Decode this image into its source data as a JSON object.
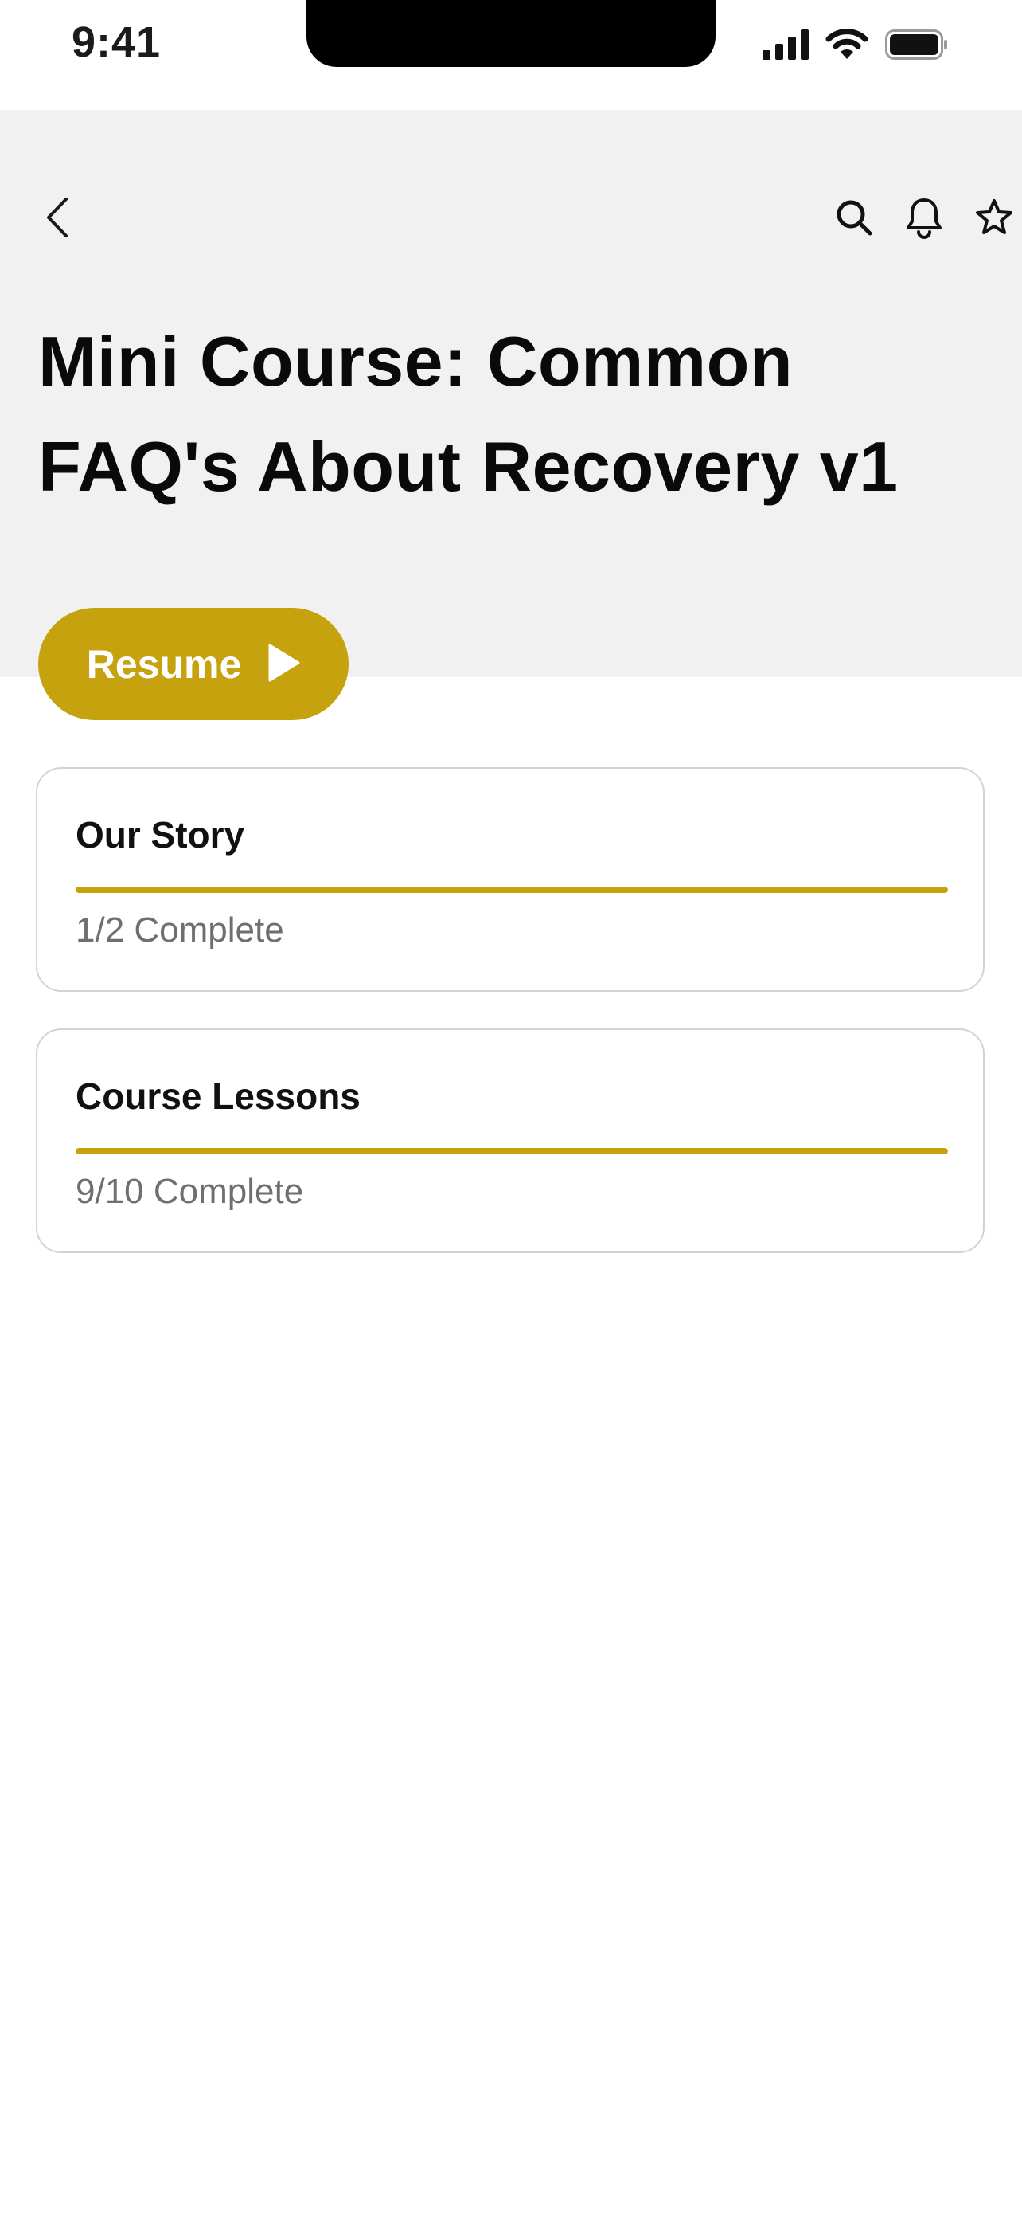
{
  "status_bar": {
    "time": "9:41",
    "icons": [
      "cellular-signal-icon",
      "wifi-icon",
      "battery-icon"
    ]
  },
  "header": {
    "back_icon": "chevron-left-icon",
    "actions": [
      "search-icon",
      "bell-icon",
      "star-icon"
    ],
    "title": "Mini Course: Common FAQ's About Recovery v1"
  },
  "resume_button": {
    "label": "Resume",
    "icon": "play-icon"
  },
  "sections": [
    {
      "title": "Our Story",
      "status": "1/2 Complete",
      "progress": 1.0
    },
    {
      "title": "Course Lessons",
      "status": "9/10 Complete",
      "progress": 1.0
    }
  ],
  "colors": {
    "accent": "#c6a20e",
    "header_background": "#f1f1f1",
    "muted_text": "#6e6e73",
    "card_border": "#d3d3d3"
  }
}
